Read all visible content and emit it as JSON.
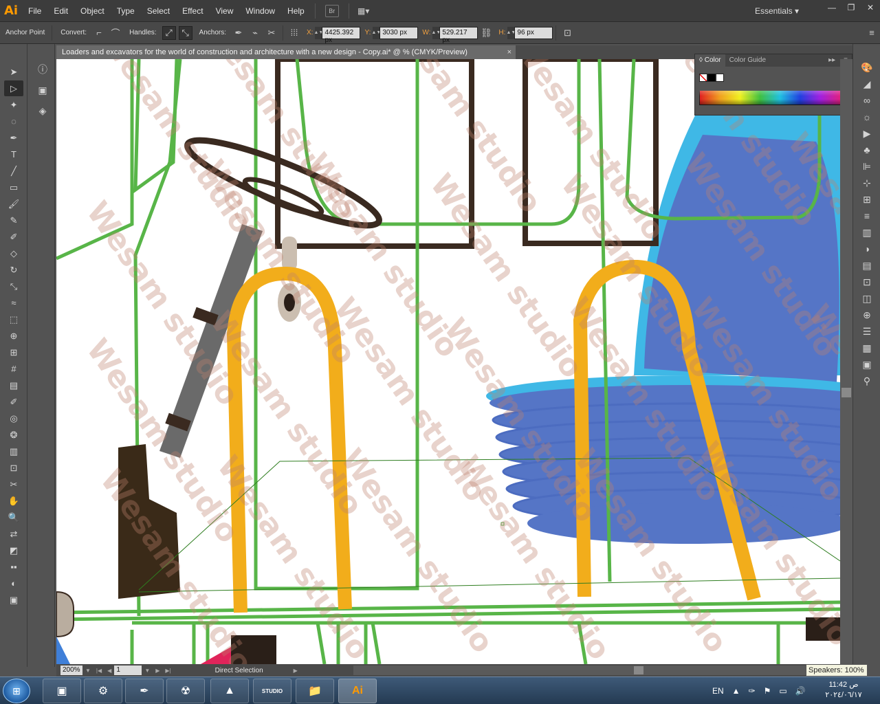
{
  "app": {
    "logo": "Ai"
  },
  "menu": [
    "File",
    "Edit",
    "Object",
    "Type",
    "Select",
    "Effect",
    "View",
    "Window",
    "Help"
  ],
  "bridge_label": "Br",
  "workspace": "Essentials",
  "control": {
    "anchor_point": "Anchor Point",
    "convert": "Convert:",
    "handles": "Handles:",
    "anchors": "Anchors:",
    "x_label": "X:",
    "x_value": "4425.392 px",
    "y_label": "Y:",
    "y_value": "3030 px",
    "w_label": "W:",
    "w_value": "529.217 px",
    "h_label": "H:",
    "h_value": "96 px"
  },
  "document": {
    "tab_title": "Loaders and excavators for the world of construction and architecture with a new design - Copy.ai* @ % (CMYK/Preview)",
    "close": "×"
  },
  "status": {
    "zoom": "200%",
    "artboard": "1",
    "tool": "Direct Selection"
  },
  "color_panel": {
    "tab_color": "Color",
    "tab_guide": "Color Guide"
  },
  "watermark": "Wesam studio",
  "tooltip": {
    "speakers": "Speakers: 100%"
  },
  "taskbar": {
    "lang": "EN",
    "time": "11:42 ص",
    "date": "٢٠٢٤/٠٦/١٧",
    "studio_label": "STUDIO"
  }
}
